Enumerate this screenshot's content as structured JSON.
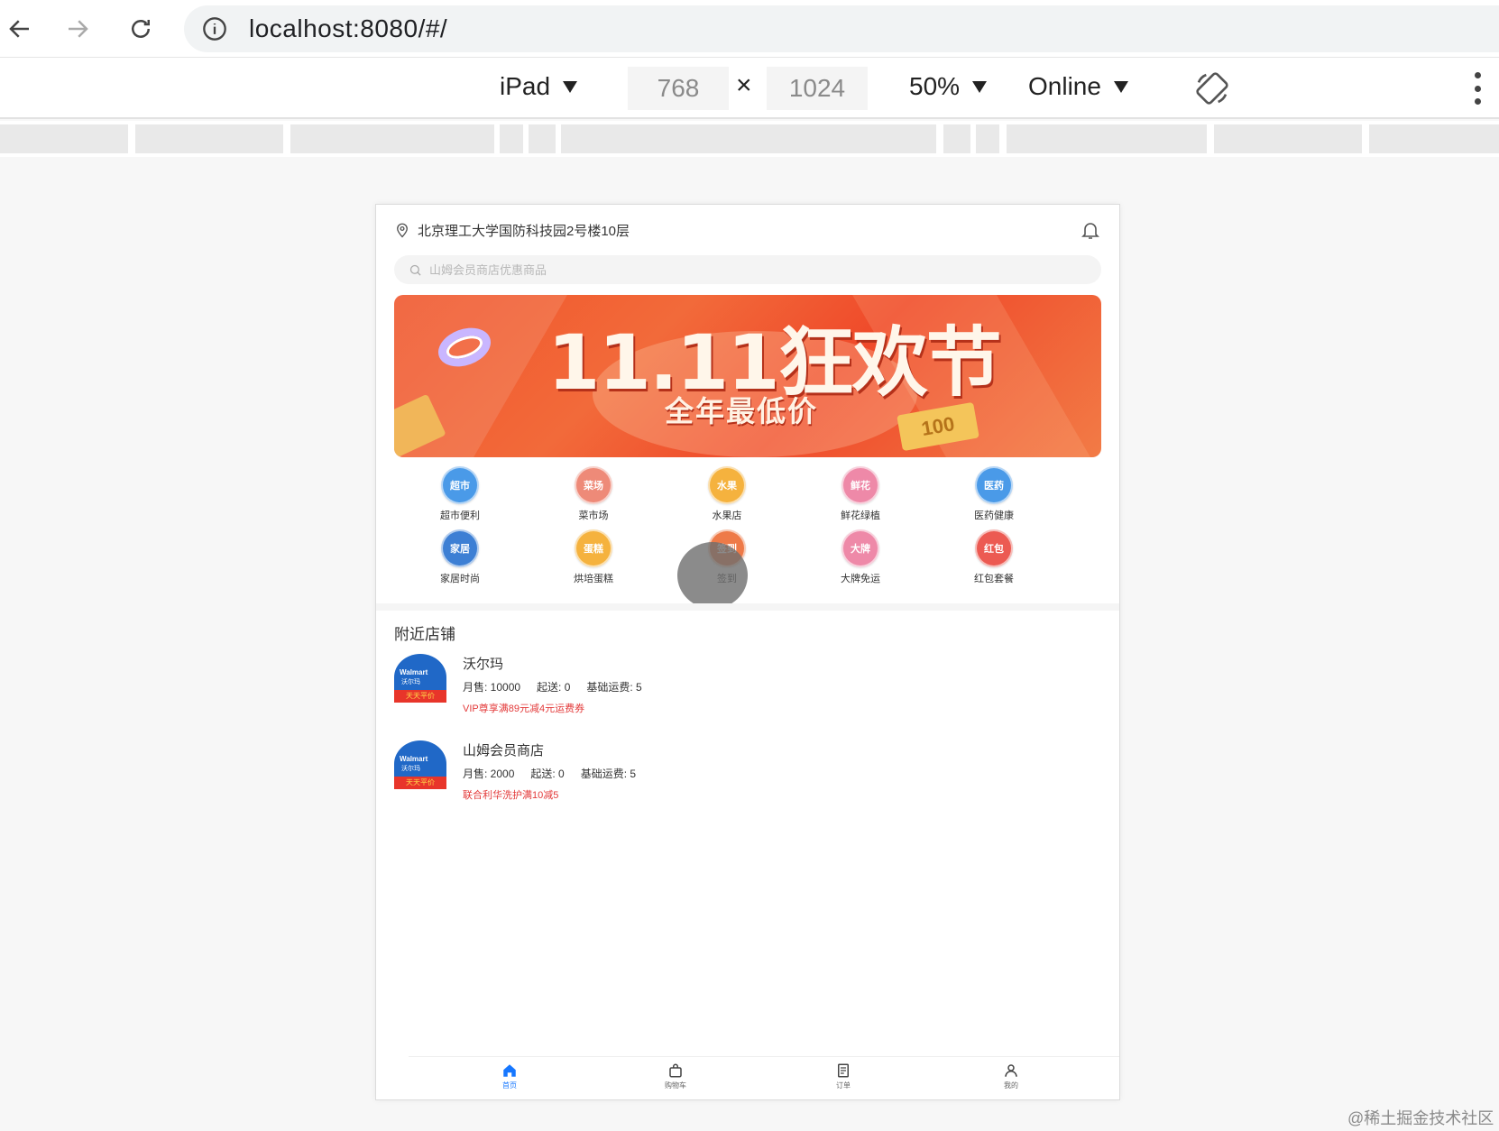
{
  "browser": {
    "url": "localhost:8080/#/"
  },
  "device_toolbar": {
    "device": "iPad",
    "width": "768",
    "times": "×",
    "height": "1024",
    "zoom": "50%",
    "network": "Online"
  },
  "app": {
    "location": "北京理工大学国防科技园2号楼10层",
    "search_placeholder": "山姆会员商店优惠商品",
    "banner": {
      "title": "11.11狂欢节",
      "subtitle": "全年最低价",
      "coupon": "100"
    },
    "categories": [
      {
        "icon_text": "超市",
        "label": "超市便利",
        "color": "#4a9ae8"
      },
      {
        "icon_text": "菜场",
        "label": "菜市场",
        "color": "#ee8a78"
      },
      {
        "icon_text": "水果",
        "label": "水果店",
        "color": "#f5b23e"
      },
      {
        "icon_text": "鲜花",
        "label": "鲜花绿植",
        "color": "#ee89a8"
      },
      {
        "icon_text": "医药",
        "label": "医药健康",
        "color": "#4a9ae8"
      },
      {
        "icon_text": "家居",
        "label": "家居时尚",
        "color": "#3d7fd4"
      },
      {
        "icon_text": "蛋糕",
        "label": "烘培蛋糕",
        "color": "#f5b23e"
      },
      {
        "icon_text": "签到",
        "label": "签到",
        "color": "#ee7a48"
      },
      {
        "icon_text": "大牌",
        "label": "大牌免运",
        "color": "#ee89a8"
      },
      {
        "icon_text": "红包",
        "label": "红包套餐",
        "color": "#ec5a52"
      }
    ],
    "nearby_title": "附近店铺",
    "shops": [
      {
        "name": "沃尔玛",
        "sales": "月售: 10000",
        "min_order": "起送: 0",
        "delivery": "基础运费: 5",
        "promo": "VIP尊享满89元减4元运费券",
        "logo_text": "Walmart",
        "logo_sub": "沃尔玛",
        "logo_strip": "天天平价"
      },
      {
        "name": "山姆会员商店",
        "sales": "月售: 2000",
        "min_order": "起送: 0",
        "delivery": "基础运费: 5",
        "promo": "联合利华洗护满10减5",
        "logo_text": "Walmart",
        "logo_sub": "沃尔玛",
        "logo_strip": "天天平价"
      }
    ],
    "tabs": [
      {
        "label": "首页",
        "icon": "home-icon"
      },
      {
        "label": "购物车",
        "icon": "bag-icon"
      },
      {
        "label": "订单",
        "icon": "order-icon"
      },
      {
        "label": "我的",
        "icon": "user-icon"
      }
    ],
    "accent_color": "#1677ff",
    "promo_color": "#e33a3a"
  },
  "watermark": "@稀土掘金技术社区"
}
